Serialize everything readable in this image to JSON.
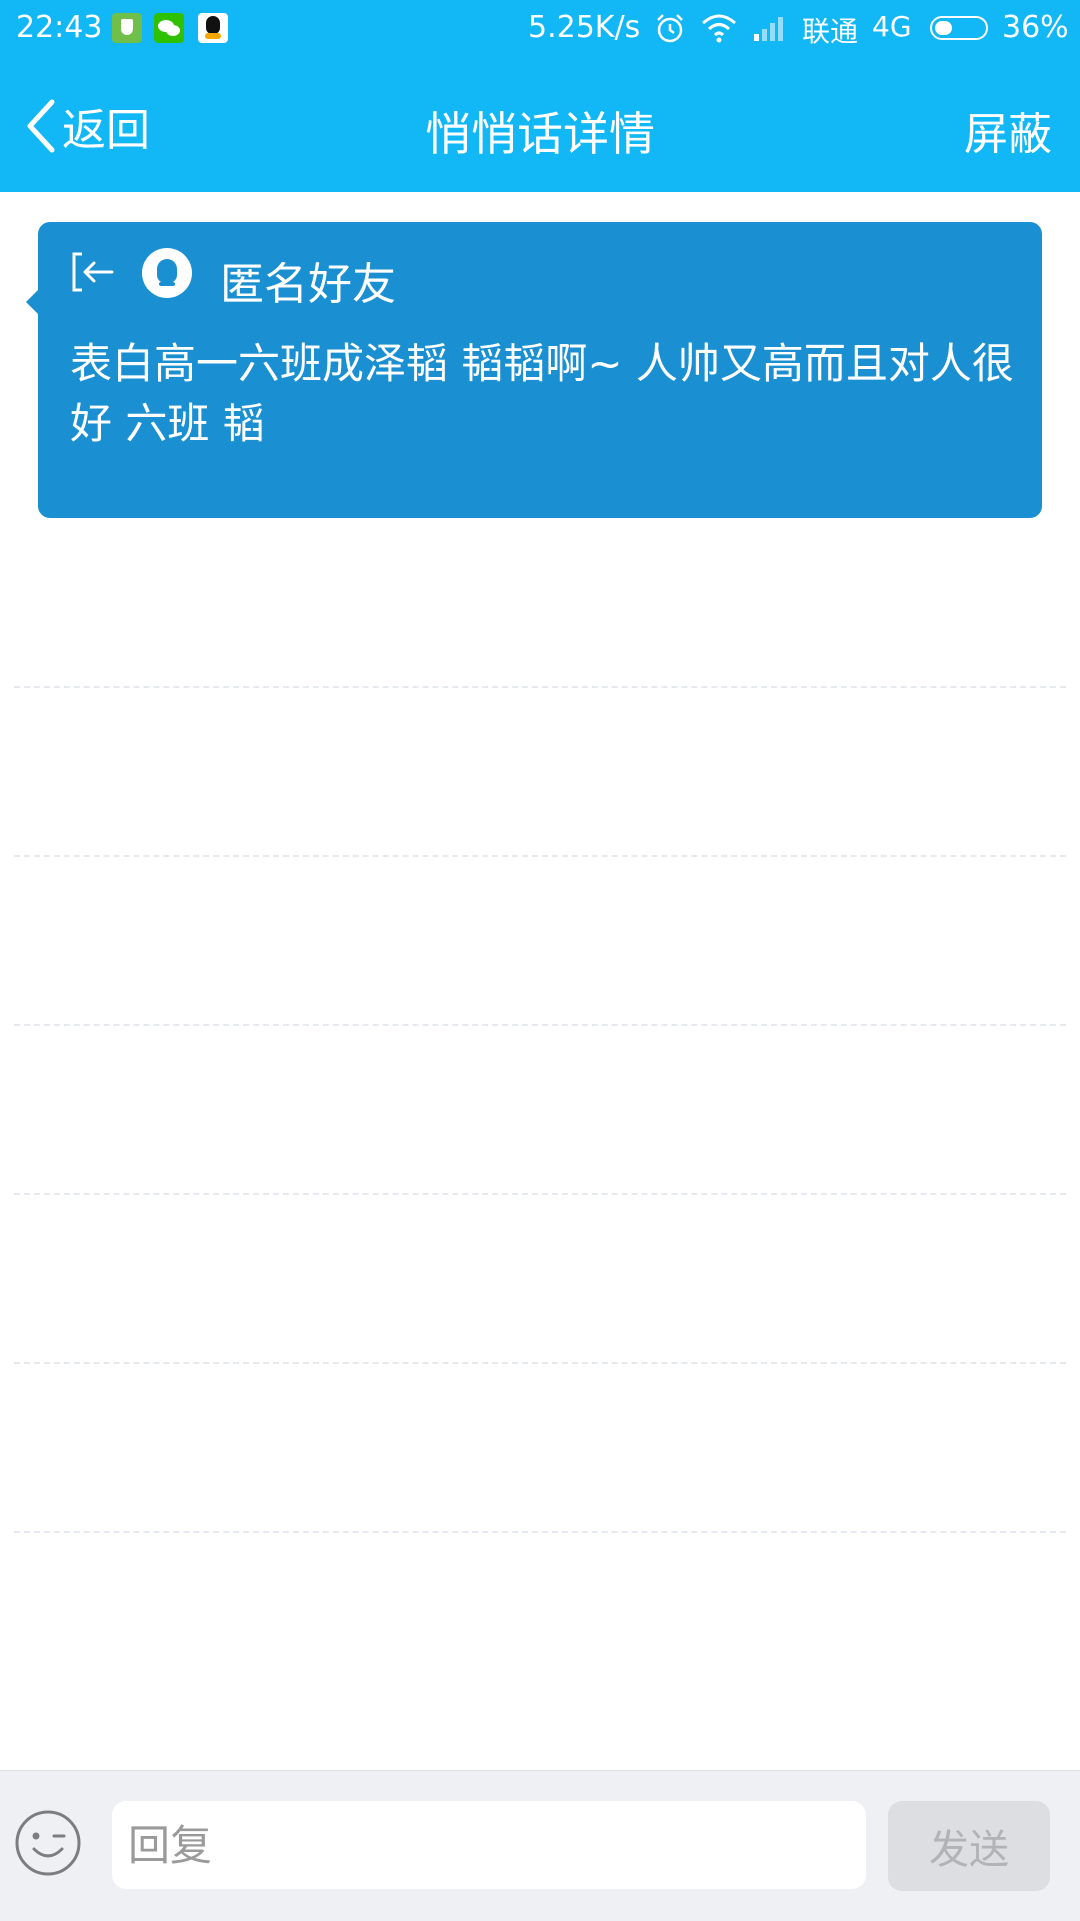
{
  "status_bar": {
    "time": "22:43",
    "net_speed": "5.25K/s",
    "carrier": "联通",
    "network": "4G",
    "battery": "36%",
    "battery_level": 0.36,
    "notification_icons": [
      "shield-icon",
      "wechat-icon",
      "qq-icon"
    ],
    "system_icons": [
      "alarm-icon",
      "wifi-icon",
      "signal-icon",
      "battery-icon"
    ]
  },
  "header": {
    "back_label": "返回",
    "title": "悄悄话详情",
    "action_label": "屏蔽"
  },
  "message": {
    "sender": "匿名好友",
    "text": "表白高一六班成泽韬 韬韬啊~  人帅又高而且对人很好  六班 韬"
  },
  "input_bar": {
    "placeholder": "回复",
    "send_label": "发送"
  },
  "colors": {
    "accent": "#12b7f5",
    "card": "#1a8fd2",
    "input_bar_bg": "#eef0f3",
    "send_disabled": "#dcdee1"
  }
}
